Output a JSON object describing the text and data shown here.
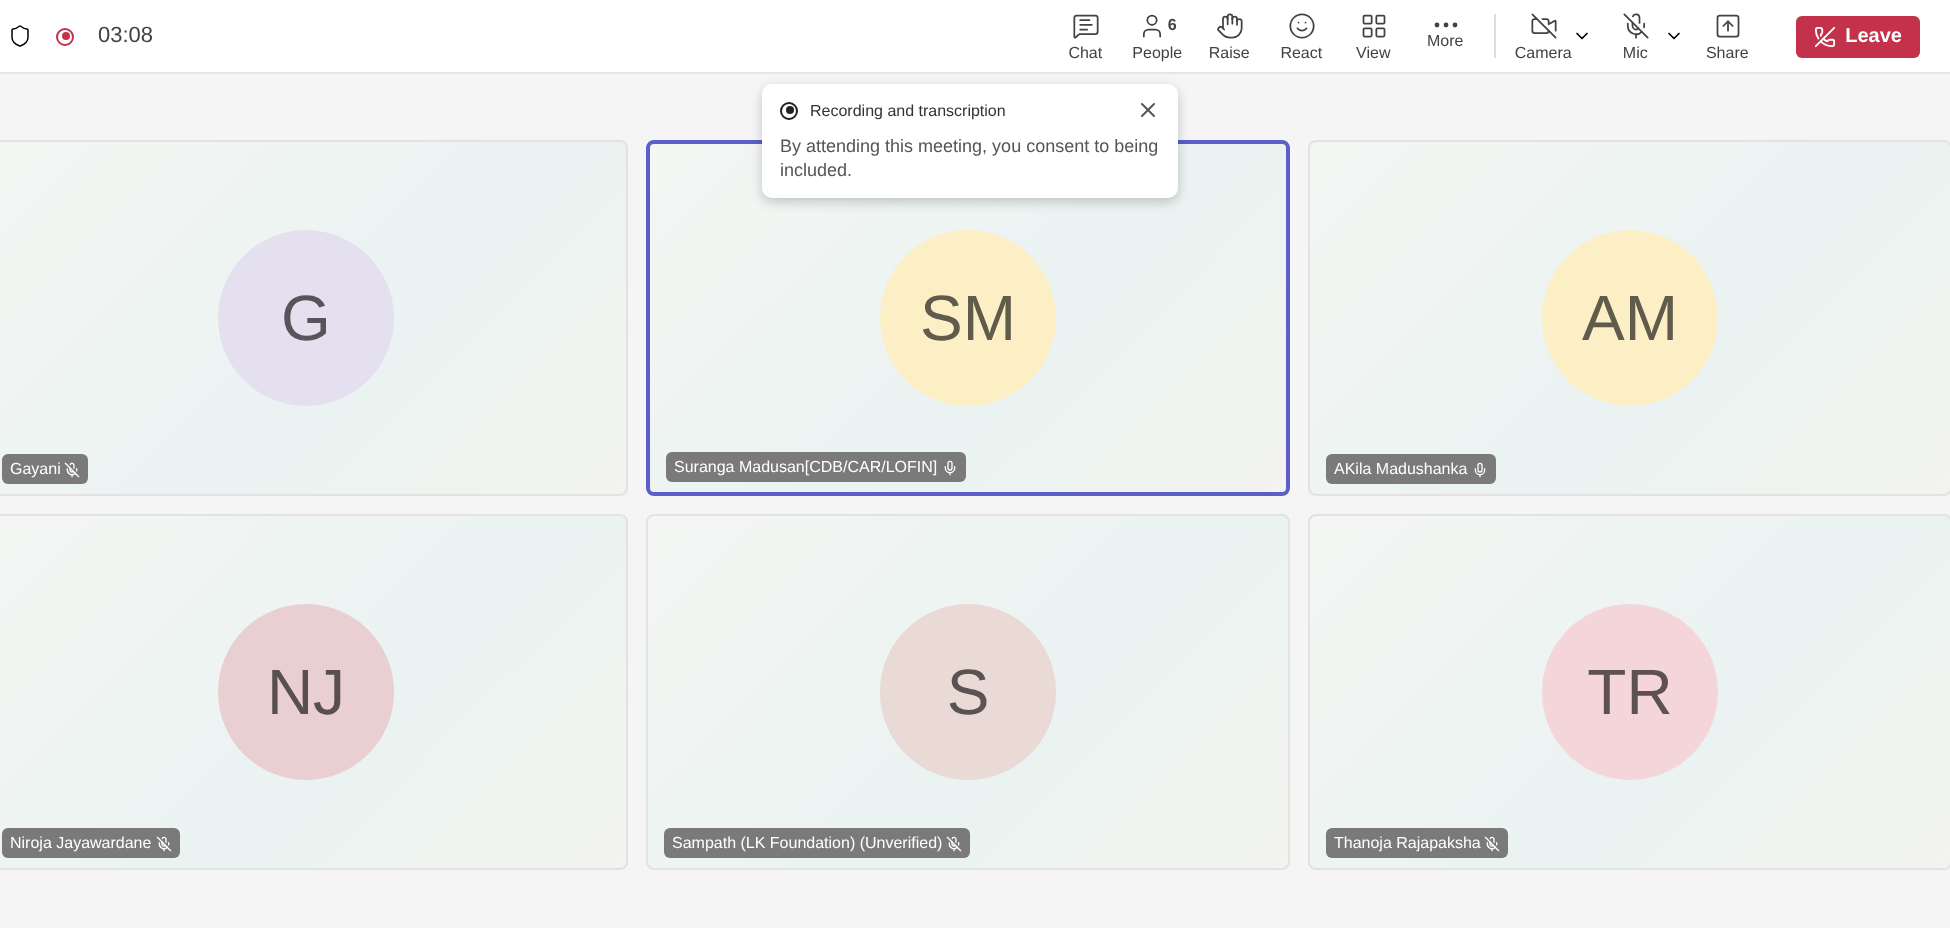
{
  "top_bar": {
    "timer": "03:08",
    "recording": true,
    "actions": [
      {
        "kind": "chat",
        "label": "Chat"
      },
      {
        "kind": "people",
        "label": "People",
        "count": "6"
      },
      {
        "kind": "raise",
        "label": "Raise"
      },
      {
        "kind": "react",
        "label": "React"
      },
      {
        "kind": "view",
        "label": "View"
      },
      {
        "kind": "more",
        "label": "More"
      },
      {
        "kind": "camera",
        "label": "Camera",
        "off": true
      },
      {
        "kind": "mic",
        "label": "Mic",
        "off": true
      },
      {
        "kind": "share",
        "label": "Share"
      }
    ],
    "leave_button": "Leave"
  },
  "notice": {
    "title": "Recording and transcription",
    "body": "By attending this meeting, you consent to being included."
  },
  "participants": [
    {
      "initials": "G",
      "name": "Gayani",
      "muted": true,
      "selected": false,
      "color": "#e4e0f0"
    },
    {
      "initials": "SM",
      "name": "Suranga Madusan[CDB/CAR/LOFIN]",
      "muted": false,
      "selected": true,
      "color": "#fcefc6"
    },
    {
      "initials": "AM",
      "name": "AKila Madushanka",
      "muted": false,
      "selected": false,
      "color": "#fcefc6"
    },
    {
      "initials": "NJ",
      "name": "Niroja Jayawardane",
      "muted": true,
      "selected": false,
      "color": "#e9cfd2"
    },
    {
      "initials": "S",
      "name": "Sampath (LK Foundation) (Unverified)",
      "muted": true,
      "selected": false,
      "color": "#e9dad6"
    },
    {
      "initials": "TR",
      "name": "Thanoja Rajapaksha",
      "muted": true,
      "selected": false,
      "color": "#f4d6da"
    }
  ]
}
